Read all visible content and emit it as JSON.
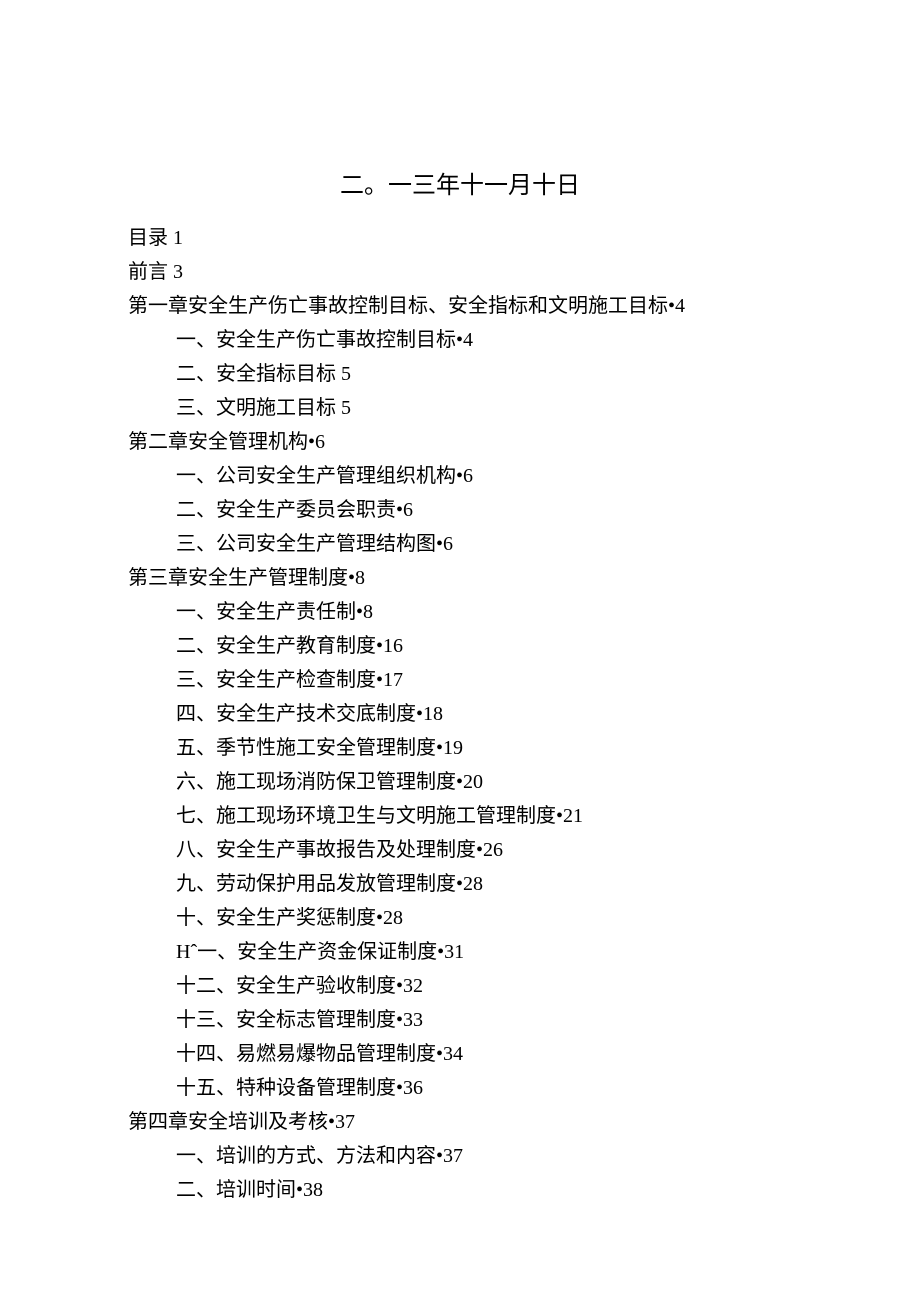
{
  "title": "二。一三年十一月十日",
  "lines": [
    {
      "text": "目录 1",
      "indent": 0
    },
    {
      "text": "前言 3",
      "indent": 0
    },
    {
      "text": "第一章安全生产伤亡事故控制目标、安全指标和文明施工目标•4",
      "indent": 0
    },
    {
      "text": "一、安全生产伤亡事故控制目标•4",
      "indent": 1
    },
    {
      "text": "二、安全指标目标 5",
      "indent": 1
    },
    {
      "text": "三、文明施工目标 5",
      "indent": 1
    },
    {
      "text": "第二章安全管理机构•6",
      "indent": 0
    },
    {
      "text": "一、公司安全生产管理组织机构•6",
      "indent": 1
    },
    {
      "text": "二、安全生产委员会职责•6",
      "indent": 1
    },
    {
      "text": "三、公司安全生产管理结构图•6",
      "indent": 1
    },
    {
      "text": "第三章安全生产管理制度•8",
      "indent": 0
    },
    {
      "text": "一、安全生产责任制•8",
      "indent": 1
    },
    {
      "text": "二、安全生产教育制度•16",
      "indent": 1
    },
    {
      "text": "三、安全生产检查制度•17",
      "indent": 1
    },
    {
      "text": "四、安全生产技术交底制度•18",
      "indent": 1
    },
    {
      "text": "五、季节性施工安全管理制度•19",
      "indent": 1
    },
    {
      "text": "六、施工现场消防保卫管理制度•20",
      "indent": 1
    },
    {
      "text": "七、施工现场环境卫生与文明施工管理制度•21",
      "indent": 1
    },
    {
      "text": "八、安全生产事故报告及处理制度•26",
      "indent": 1
    },
    {
      "text": "九、劳动保护用品发放管理制度•28",
      "indent": 1
    },
    {
      "text": "十、安全生产奖惩制度•28",
      "indent": 1
    },
    {
      "text": "Hˆ一、安全生产资金保证制度•31",
      "indent": 1
    },
    {
      "text": "十二、安全生产验收制度•32",
      "indent": 1
    },
    {
      "text": "十三、安全标志管理制度•33",
      "indent": 1
    },
    {
      "text": "十四、易燃易爆物品管理制度•34",
      "indent": 1
    },
    {
      "text": "十五、特种设备管理制度•36",
      "indent": 1
    },
    {
      "text": "第四章安全培训及考核•37",
      "indent": 0
    },
    {
      "text": "一、培训的方式、方法和内容•37",
      "indent": 1
    },
    {
      "text": "二、培训时间•38",
      "indent": 1
    }
  ]
}
